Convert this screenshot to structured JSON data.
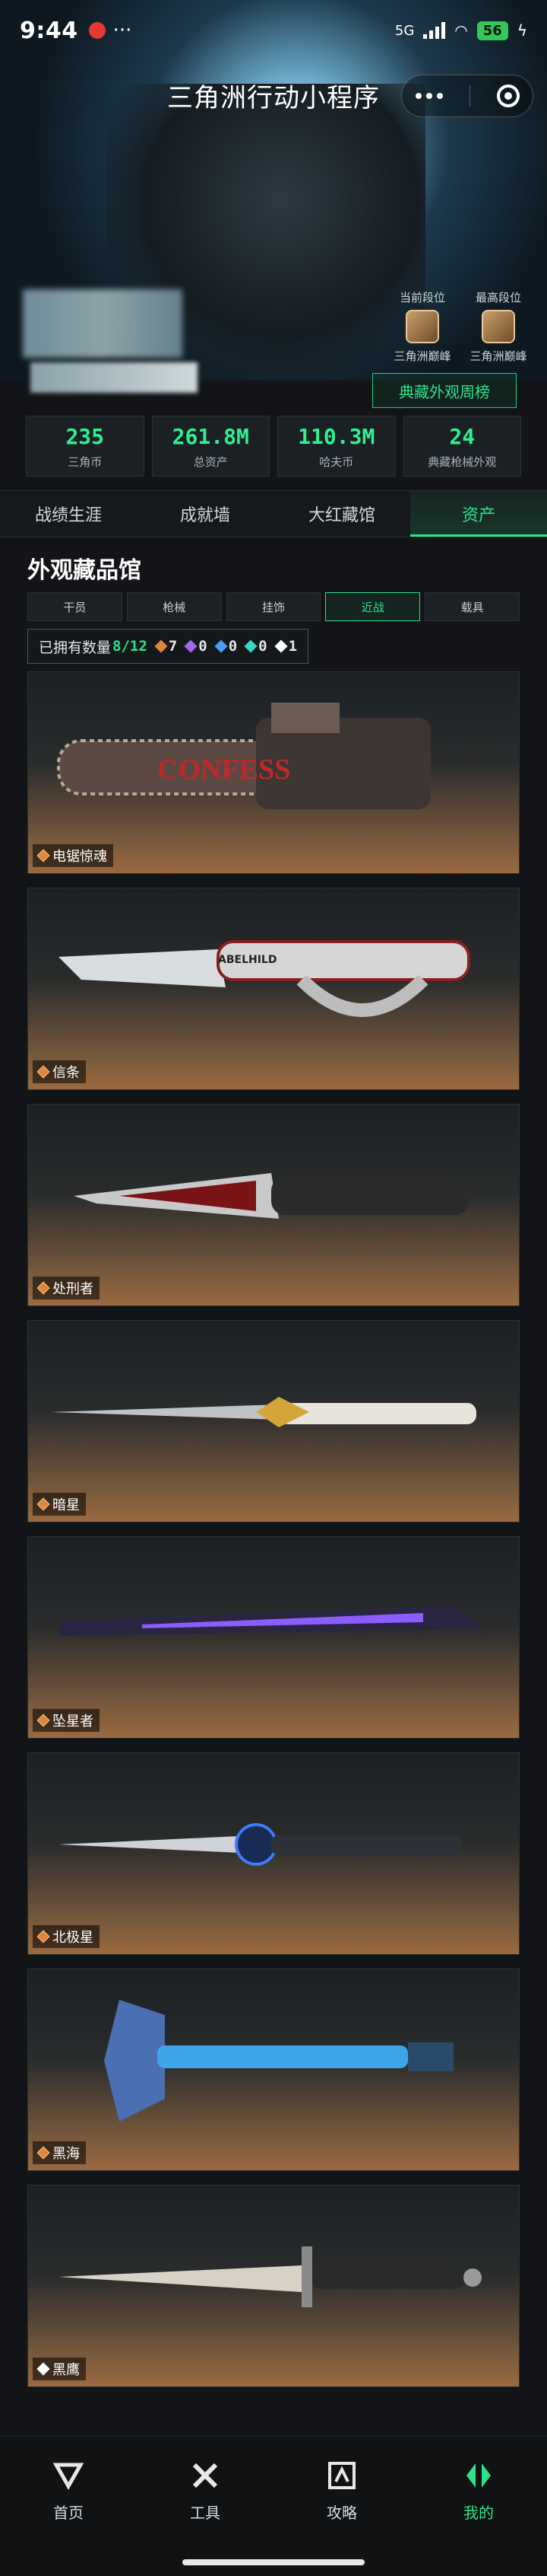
{
  "status_bar": {
    "time": "9:44",
    "network": "5G",
    "battery": "56"
  },
  "header": {
    "title": "三角洲行动小程序"
  },
  "ranks": [
    {
      "title": "当前段位",
      "name": "三角洲巅峰"
    },
    {
      "title": "最高段位",
      "name": "三角洲巅峰"
    }
  ],
  "weekly_button": "典藏外观周榜",
  "stats": [
    {
      "value": "235",
      "label": "三角币"
    },
    {
      "value": "261.8M",
      "label": "总资产"
    },
    {
      "value": "110.3M",
      "label": "哈夫币"
    },
    {
      "value": "24",
      "label": "典藏枪械外观"
    }
  ],
  "tabs": [
    "战绩生涯",
    "成就墙",
    "大红藏馆",
    "资产"
  ],
  "active_tab": 3,
  "section_title": "外观藏品馆",
  "filters": [
    "干员",
    "枪械",
    "挂饰",
    "近战",
    "载具"
  ],
  "active_filter": 3,
  "owned": {
    "label": "已拥有数量",
    "count": "8/12",
    "gems": [
      {
        "color": "#e0863a",
        "value": "7"
      },
      {
        "color": "#9b6cf0",
        "value": "0"
      },
      {
        "color": "#4a9cf5",
        "value": "0"
      },
      {
        "color": "#38d6c6",
        "value": "0"
      },
      {
        "color": "#ffffff",
        "value": "1"
      }
    ]
  },
  "items": [
    {
      "name": "电锯惊魂",
      "rarity": "orange",
      "icon": "chainsaw-icon",
      "decal": "CONFESS"
    },
    {
      "name": "信条",
      "rarity": "orange",
      "icon": "knuckle-knife-icon",
      "decal": "ABELHILD"
    },
    {
      "name": "处刑者",
      "rarity": "orange",
      "icon": "combat-knife-icon"
    },
    {
      "name": "暗星",
      "rarity": "orange",
      "icon": "golden-dagger-icon"
    },
    {
      "name": "坠星者",
      "rarity": "orange",
      "icon": "purple-blade-icon"
    },
    {
      "name": "北极星",
      "rarity": "orange",
      "icon": "blue-dagger-icon"
    },
    {
      "name": "黑海",
      "rarity": "orange",
      "icon": "tomahawk-icon"
    },
    {
      "name": "黑鹰",
      "rarity": "white",
      "icon": "bayonet-icon"
    }
  ],
  "bottom_nav": [
    {
      "label": "首页",
      "icon": "home-logo-icon"
    },
    {
      "label": "工具",
      "icon": "tools-icon"
    },
    {
      "label": "攻略",
      "icon": "guide-icon"
    },
    {
      "label": "我的",
      "icon": "profile-logo-icon"
    }
  ],
  "active_nav": 3
}
